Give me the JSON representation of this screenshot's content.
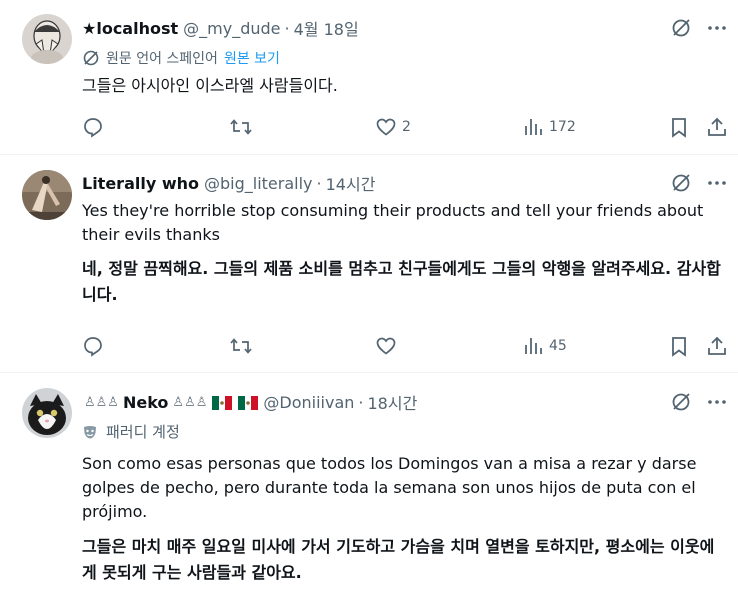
{
  "tweets": [
    {
      "display_name": "★localhost",
      "handle": "@_my_dude",
      "time": "4월 18일",
      "translation_note": "원문 언어 스페인어",
      "translation_link": "원본 보기",
      "text": "그들은 아시아인 이스라엘 사람들이다.",
      "reply_count": "",
      "retweet_count": "",
      "like_count": "2",
      "view_count": "172"
    },
    {
      "display_name": "Literally who",
      "handle": "@big_literally",
      "time": "14시간",
      "text": "Yes they're horrible stop consuming their products and tell your friends about their evils thanks",
      "translated_text": "네, 정말 끔찍해요. 그들의 제품 소비를 멈추고 친구들에게도 그들의 악행을 알려주세요. 감사합니다.",
      "reply_count": "",
      "retweet_count": "",
      "like_count": "",
      "view_count": "45"
    },
    {
      "display_name": "Neko",
      "name_emoji_prefix": "♙♙♙",
      "name_emoji_suffix": "♙♙♙",
      "handle": "@Doniiivan",
      "time": "18시간",
      "parody_label": "패러디 계정",
      "text": "Son como esas personas que todos los Domingos van a misa a rezar y darse golpes de pecho, pero durante toda la semana son unos hijos de puta con el prójimo.",
      "translated_text": "그들은 마치 매주 일요일 미사에 가서 기도하고 가슴을 치며 열변을 토하지만, 평소에는 이웃에게 못되게 구는 사람들과 같아요."
    }
  ],
  "icons": {
    "reply": "reply-icon",
    "retweet": "retweet-icon",
    "like": "heart-icon",
    "views": "views-icon",
    "bookmark": "bookmark-icon",
    "share": "share-icon",
    "grok": "grok-icon",
    "more": "more-icon",
    "translate": "translate-icon",
    "parody": "parody-mask-icon"
  },
  "colors": {
    "text": "#0f1419",
    "secondary": "#536471",
    "link": "#1d9bf0",
    "divider": "#eff3f4"
  }
}
